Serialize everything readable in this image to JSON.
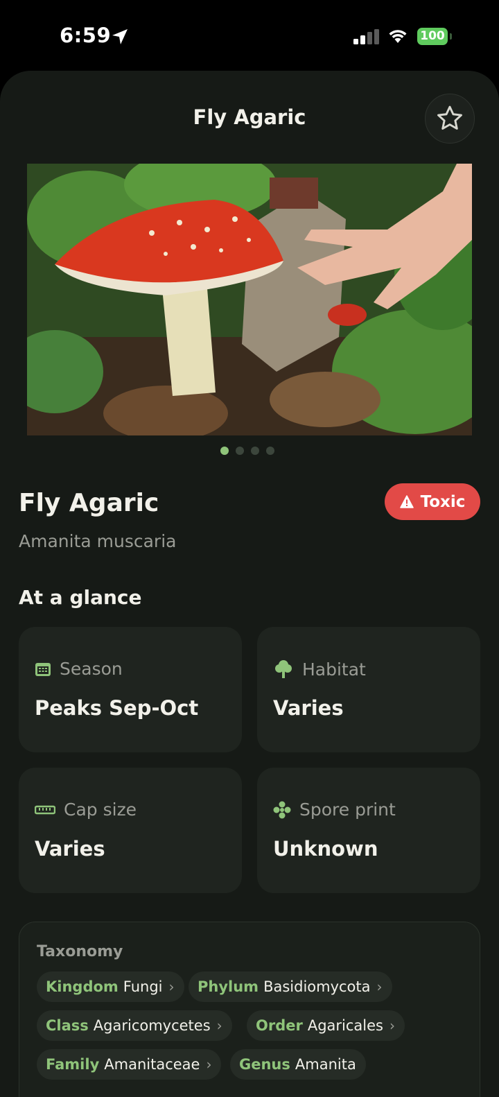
{
  "status_bar": {
    "time": "6:59",
    "battery": "100"
  },
  "header": {
    "title": "Fly Agaric",
    "favorite_icon": "star-icon"
  },
  "gallery": {
    "image_count": 4,
    "active_index": 0
  },
  "species": {
    "common_name": "Fly Agaric",
    "scientific_name": "Amanita muscaria",
    "toxicity": "Toxic"
  },
  "at_a_glance": {
    "heading": "At a glance",
    "cards": [
      {
        "icon": "calendar-icon",
        "label": "Season",
        "value": "Peaks Sep-Oct"
      },
      {
        "icon": "tree-icon",
        "label": "Habitat",
        "value": "Varies"
      },
      {
        "icon": "ruler-icon",
        "label": "Cap size",
        "value": "Varies"
      },
      {
        "icon": "spore-icon",
        "label": "Spore print",
        "value": "Unknown"
      }
    ]
  },
  "taxonomy": {
    "heading": "Taxonomy",
    "ranks": [
      {
        "rank": "Kingdom",
        "value": "Fungi"
      },
      {
        "rank": "Phylum",
        "value": "Basidiomycota"
      },
      {
        "rank": "Class",
        "value": "Agaricomycetes"
      },
      {
        "rank": "Order",
        "value": "Agaricales"
      },
      {
        "rank": "Family",
        "value": "Amanitaceae"
      },
      {
        "rank": "Genus",
        "value": "Amanita"
      }
    ]
  },
  "colors": {
    "accent": "#8fc47a",
    "toxic": "#e24a47",
    "background": "#161a16"
  }
}
